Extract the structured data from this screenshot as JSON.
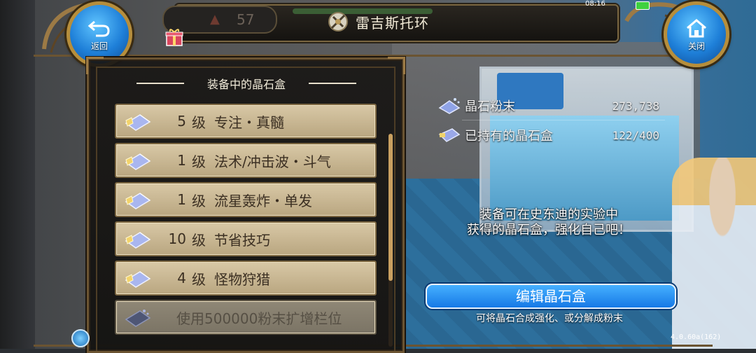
{
  "header": {
    "title": "雷吉斯托环",
    "hp_value": "57",
    "back_label": "返回",
    "close_label": "关闭"
  },
  "status_bar": {
    "time": "08:16"
  },
  "panel": {
    "heading": "装备中的晶石盒",
    "slots": [
      {
        "level": "5",
        "level_word": "级",
        "name": "专注・真髓"
      },
      {
        "level": "1",
        "level_word": "级",
        "name": "法术/冲击波・斗气"
      },
      {
        "level": "1",
        "level_word": "级",
        "name": "流星轰炸・单发"
      },
      {
        "level": "10",
        "level_word": "级",
        "name": "节省技巧"
      },
      {
        "level": "4",
        "level_word": "级",
        "name": "怪物狩猎"
      }
    ],
    "expand_label": "使用500000粉末扩增栏位"
  },
  "info": {
    "powder_label": "晶石粉末",
    "powder_value": "273,738",
    "boxes_label": "已持有的晶石盒",
    "boxes_value": "122/400"
  },
  "description": {
    "line1": "装备可在史东迪的实验中",
    "line2": "获得的晶石盒，强化自己吧！"
  },
  "edit_button_label": "编辑晶石盒",
  "hint": "可将晶石合成强化、或分解成粉末",
  "version": "4.0.60a(162)",
  "colors": {
    "accent_blue": "#1e7fd8",
    "slot_bg": "#d8c8a6",
    "frame_gold": "#b68e3c"
  },
  "icons": {
    "back": "back-arrow-icon",
    "close": "home-icon",
    "title": "guild-emblem-icon",
    "gift": "gift-icon",
    "gem": "crystal-gem-icon"
  }
}
